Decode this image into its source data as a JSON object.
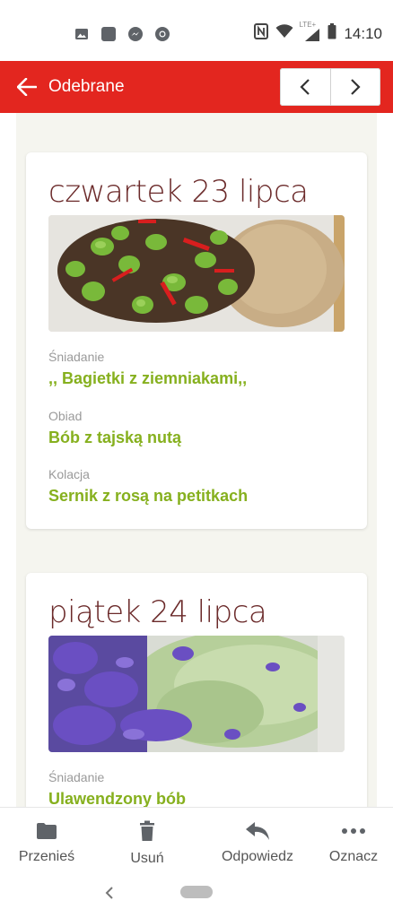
{
  "status_bar": {
    "time": "14:10",
    "network_label": "LTE+",
    "left_icons": [
      "image-icon",
      "app-square-icon",
      "messenger-icon",
      "chrome-icon"
    ],
    "right_icons": [
      "nfc-icon",
      "wifi-icon",
      "signal-icon",
      "battery-icon"
    ]
  },
  "header": {
    "title": "Odebrane",
    "accent_color": "#e3261f"
  },
  "cards": [
    {
      "date": "czwartek 23 lipca",
      "image": "fava-beans-with-rice",
      "meals": [
        {
          "label": "Śniadanie",
          "name": ",, Bagietki z ziemniakami,,"
        },
        {
          "label": "Obiad",
          "name": "Bób z tajską nutą"
        },
        {
          "label": "Kolacja",
          "name": "Sernik z rosą na petitkach"
        }
      ]
    },
    {
      "date": "piątek 24 lipca",
      "image": "lavender-bean-spread",
      "meals": [
        {
          "label": "Śniadanie",
          "name": "Ulawendzony bób"
        }
      ]
    }
  ],
  "actions": {
    "move": "Przenieś",
    "delete": "Usuń",
    "reply": "Odpowiedz",
    "mark": "Oznacz"
  },
  "colors": {
    "meal_name": "#86b01e",
    "date_text": "#6b2a2a",
    "content_bg": "#f5f5ef"
  }
}
